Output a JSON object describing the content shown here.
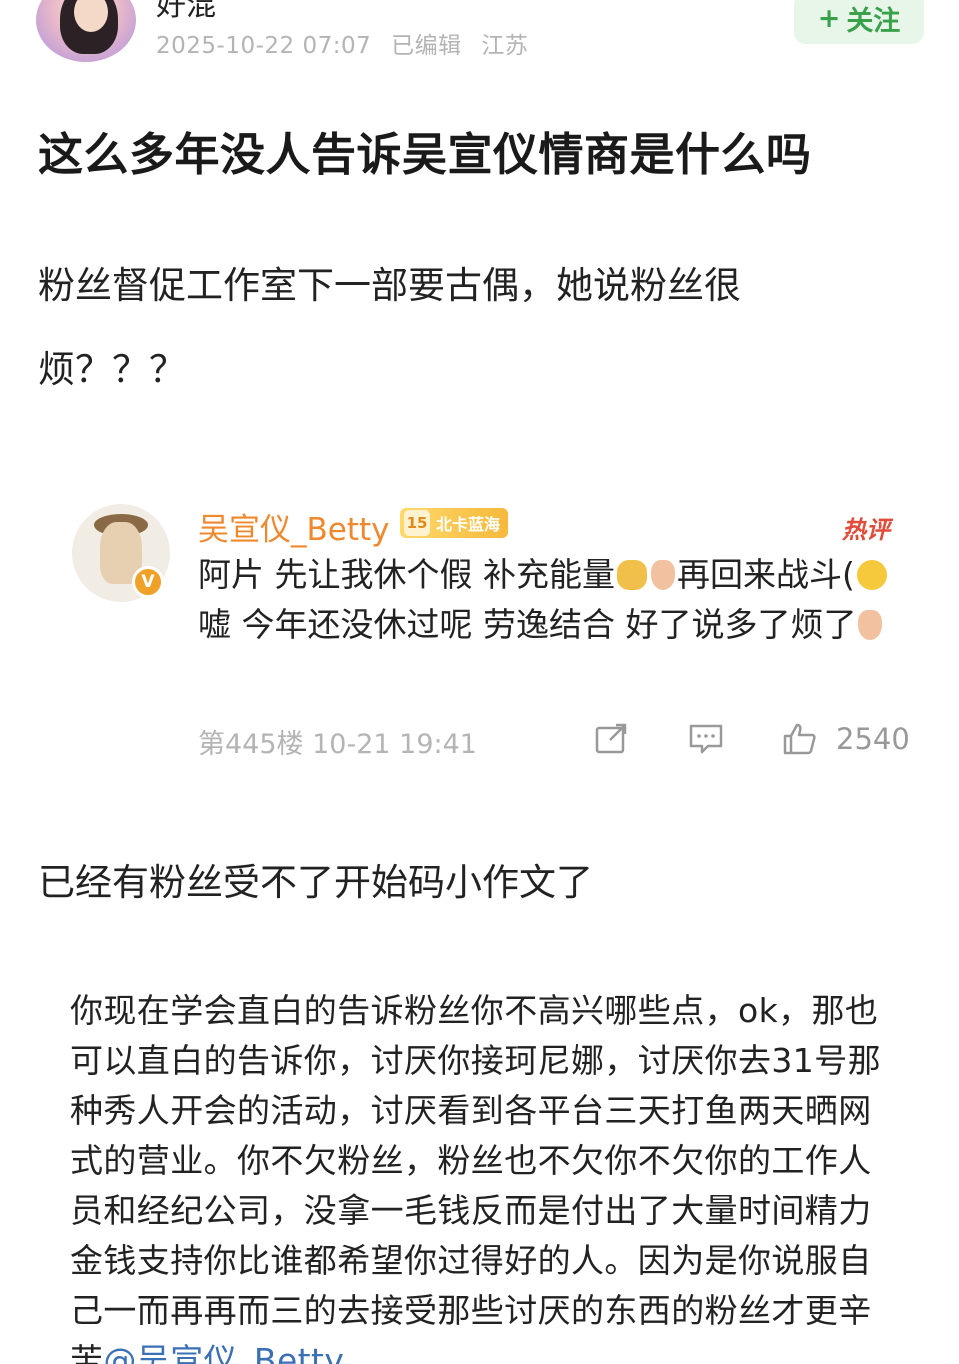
{
  "header": {
    "author_name": "好混",
    "post_time": "2025-10-22 07:07",
    "edited": "已编辑",
    "location": "江苏",
    "follow_label": "关注"
  },
  "post": {
    "title": "这么多年没人告诉吴宣仪情商是什么吗",
    "paragraph1": "粉丝督促工作室下一部要古偶，她说粉丝很烦？？？",
    "paragraph2": "已经有粉丝受不了开始码小作文了"
  },
  "comment": {
    "user_name": "吴宣仪_Betty",
    "level": "15",
    "badge_text": "北卡蓝海",
    "verified": "V",
    "hot_label": "热评",
    "text_part1": "阿片 先让我休个假 补充能量",
    "text_part2": "再回来战斗(",
    "text_part3": "嘘 今年还没休过呢 劳逸结合 好了说多了烦了",
    "floor_info": "第445楼 10-21 19:41",
    "like_count": "2540",
    "icons": [
      "share-icon",
      "reply-icon",
      "like-icon"
    ]
  },
  "long_text": {
    "body": "你现在学会直白的告诉粉丝你不高兴哪些点，ok，那也可以直白的告诉你，讨厌你接珂尼娜，讨厌你去31号那种秀人开会的活动，讨厌看到各平台三天打鱼两天晒网式的营业。你不欠粉丝，粉丝也不欠你不欠你的工作人员和经纪公司，没拿一毛钱反而是付出了大量时间精力金钱支持你比谁都希望你过得好的人。因为是你说服自己一而再再而三的去接受那些讨厌的东西的粉丝才更辛苦",
    "mention": "@吴宣仪_Betty"
  }
}
